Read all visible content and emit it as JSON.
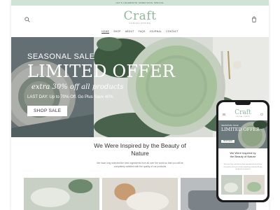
{
  "announcement": "LET'S CELEBRATE SOMETHING SPECIAL",
  "brand": {
    "name": "Craft",
    "tagline": "CASUAL DINING"
  },
  "nav": [
    "HOME",
    "SHOP",
    "ABOUT",
    "FAQS",
    "JOURNAL",
    "CONTACT"
  ],
  "icons": {
    "search": "search-icon",
    "cart": "cart-icon",
    "menu": "hamburger-menu-icon"
  },
  "hero": {
    "eyebrow": "SEASONAL SALE",
    "headline": "LIMITED OFFER",
    "script": "extra 30% off all products",
    "subtext": "LAST DAY: Up to 70% Off. Go Plus Save 40%",
    "button": "SHOP SALE"
  },
  "section": {
    "title_line1": "We Were Inspired by the Beauty of",
    "title_line2": "Nature",
    "body_line1": "We have long selected the best ingredients from all over the world so that you will be",
    "body_line2": "completely satisfied with the quality of our products"
  },
  "mobile": {
    "title_line1": "We Were Inspired by",
    "title_line2": "the Beauty of Nature"
  },
  "colors": {
    "accent": "#8fb89b",
    "announcement_bg": "#cfe3d6",
    "plate_green": "#a7c19d",
    "phone_frame": "#1b1b1b"
  }
}
